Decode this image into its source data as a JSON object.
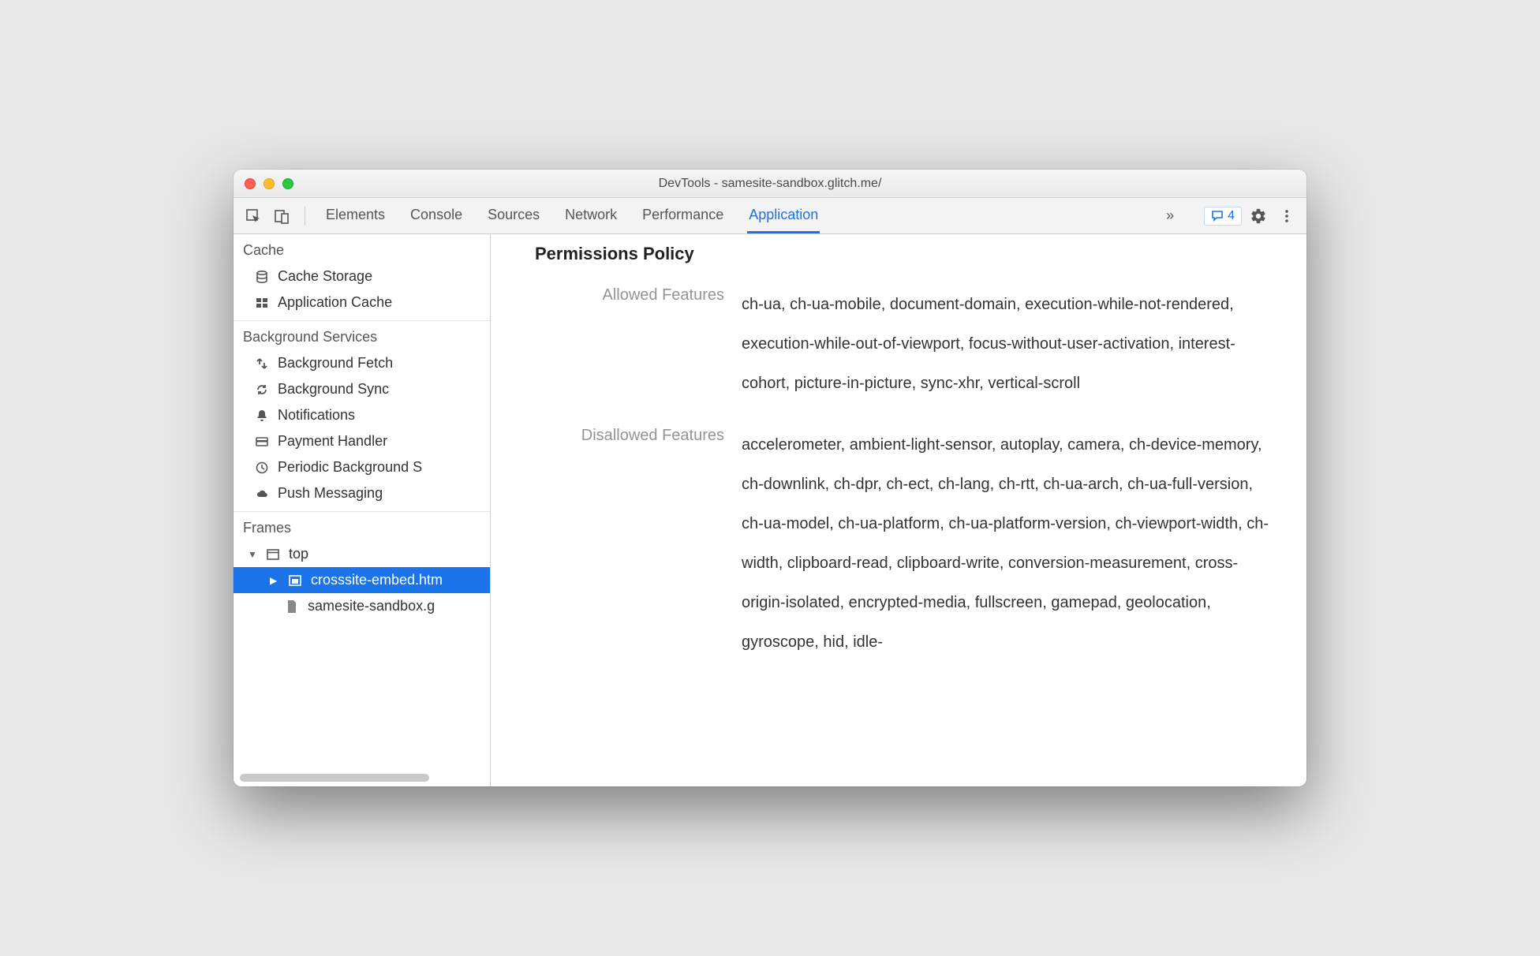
{
  "window": {
    "title": "DevTools - samesite-sandbox.glitch.me/"
  },
  "toolbar": {
    "tabs": [
      "Elements",
      "Console",
      "Sources",
      "Network",
      "Performance",
      "Application"
    ],
    "active_tab_index": 5,
    "overflow": "»",
    "message_count": "4"
  },
  "sidebar": {
    "cache": {
      "header": "Cache",
      "items": [
        "Cache Storage",
        "Application Cache"
      ]
    },
    "background_services": {
      "header": "Background Services",
      "items": [
        "Background Fetch",
        "Background Sync",
        "Notifications",
        "Payment Handler",
        "Periodic Background S",
        "Push Messaging"
      ]
    },
    "frames": {
      "header": "Frames",
      "top": "top",
      "embed": "crosssite-embed.htm",
      "doc": "samesite-sandbox.g"
    }
  },
  "details": {
    "heading": "Permissions Policy",
    "allowed_label": "Allowed Features",
    "allowed_value": "ch-ua, ch-ua-mobile, document-domain, execution-while-not-rendered, execution-while-out-of-viewport, focus-without-user-activation, interest-cohort, picture-in-picture, sync-xhr, vertical-scroll",
    "disallowed_label": "Disallowed Features",
    "disallowed_value": "accelerometer, ambient-light-sensor, autoplay, camera, ch-device-memory, ch-downlink, ch-dpr, ch-ect, ch-lang, ch-rtt, ch-ua-arch, ch-ua-full-version, ch-ua-model, ch-ua-platform, ch-ua-platform-version, ch-viewport-width, ch-width, clipboard-read, clipboard-write, conversion-measurement, cross-origin-isolated, encrypted-media, fullscreen, gamepad, geolocation, gyroscope, hid, idle-"
  }
}
